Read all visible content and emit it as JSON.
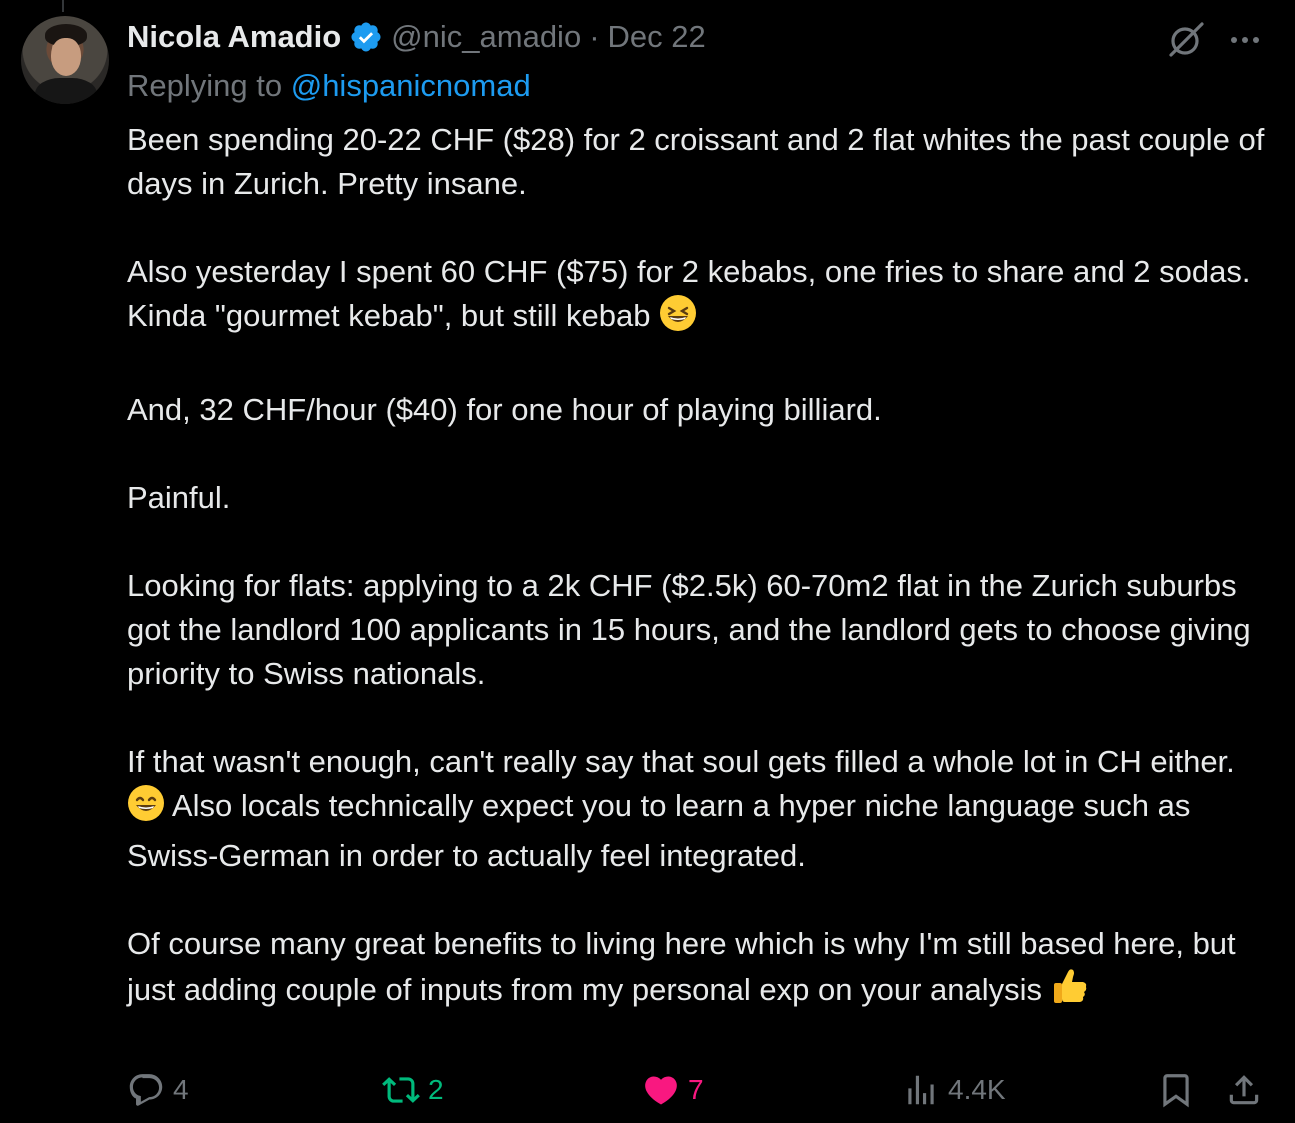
{
  "tweet": {
    "author_name": "Nicola Amadio",
    "handle": "@nic_amadio",
    "separator": "·",
    "date": "Dec 22",
    "replying_prefix": "Replying to",
    "replying_to": "@hispanicnomad",
    "paragraphs": [
      [
        "Been spending 20-22 CHF ($28) for 2 croissant and 2 flat whites the past couple of days in Zurich. Pretty insane."
      ],
      [
        "Also yesterday I spent 60 CHF ($75) for 2 kebabs, one fries to share and 2 sodas. Kinda \"gourmet kebab\", but still kebab "
      ],
      [
        "And, 32 CHF/hour ($40) for one hour of playing billiard."
      ],
      [
        "Painful."
      ],
      [
        "Looking for flats: applying to a 2k CHF ($2.5k) 60-70m2 flat in the Zurich suburbs got the landlord 100 applicants in 15 hours, and the landlord gets to choose giving priority to Swiss nationals."
      ],
      [
        "If that wasn't enough, can't really say that soul gets filled a whole lot in CH either. ",
        " Also locals technically expect you to learn a hyper niche language such as Swiss-German in order to actually feel integrated."
      ],
      [
        "Of course many great benefits to living here which is why I'm still based here, but just adding couple of inputs from my personal exp on your analysis "
      ]
    ],
    "emojis": {
      "p2_end": "grinning-squinting-face",
      "p6_mid": "grinning-face-with-smiling-eyes",
      "p7_end": "thumbs-up"
    }
  },
  "actions": {
    "replies": "4",
    "retweets": "2",
    "likes": "7",
    "views": "4.4K"
  },
  "colors": {
    "background": "#000000",
    "text": "#e7e9ea",
    "muted": "#71767b",
    "link": "#1d9bf0",
    "retweet": "#00ba7c",
    "like": "#f91880",
    "verified": "#1d9bf0"
  },
  "icons": [
    "verified-badge-icon",
    "grok-icon",
    "more-icon",
    "reply-icon",
    "retweet-icon",
    "like-icon",
    "views-icon",
    "bookmark-icon",
    "share-icon"
  ]
}
